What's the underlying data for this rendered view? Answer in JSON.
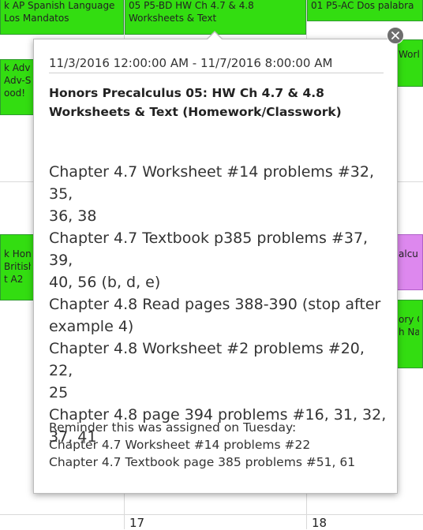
{
  "background_events": {
    "top_left": [
      "k AP Spanish Language",
      "Los Mandatos"
    ],
    "top_center": [
      "05 P5-BD HW Ch 4.7 & 4.8",
      "Worksheets & Text"
    ],
    "top_right": [
      "01 P5-AC  Dos palabra"
    ],
    "left_mid": [
      "k Advis",
      "Adv-Sop",
      "ood!"
    ],
    "right_mid": [
      "World H"
    ],
    "left_lower": [
      "k Hono",
      "British L",
      "t A2"
    ],
    "right_lower_purple": [
      "alculu"
    ],
    "right_lower_green": [
      "ory C",
      "h Na"
    ]
  },
  "day_numbers": {
    "center": "17",
    "right": "18"
  },
  "popup": {
    "date_range": "11/3/2016 12:00:00 AM - 11/7/2016 8:00:00 AM",
    "title_lines": [
      "Honors Precalculus 05: HW Ch 4.7 & 4.8",
      "Worksheets & Text (Homework/Classwork)"
    ],
    "description_lines": [
      "Chapter 4.7 Worksheet #14 problems #32, 35,",
      "36, 38",
      "Chapter 4.7 Textbook p385 problems #37, 39,",
      "40, 56 (b, d, e)",
      "Chapter 4.8 Read pages 388-390 (stop after",
      "example 4)",
      "Chapter 4.8 Worksheet #2 problems #20, 22,",
      "25",
      "Chapter 4.8 page 394 problems #16, 31, 32,",
      "37, 41"
    ],
    "reminder_lines": [
      "Reminder this was assigned on Tuesday:",
      "Chapter 4.7 Worksheet #14 problems #22",
      "Chapter 4.7 Textbook page 385 problems #51, 61"
    ]
  },
  "colors": {
    "event_green": "#33dd11",
    "event_purple": "#dd88ee",
    "close_button": "#6e6e6e"
  },
  "icons": {
    "close": "close-icon"
  }
}
